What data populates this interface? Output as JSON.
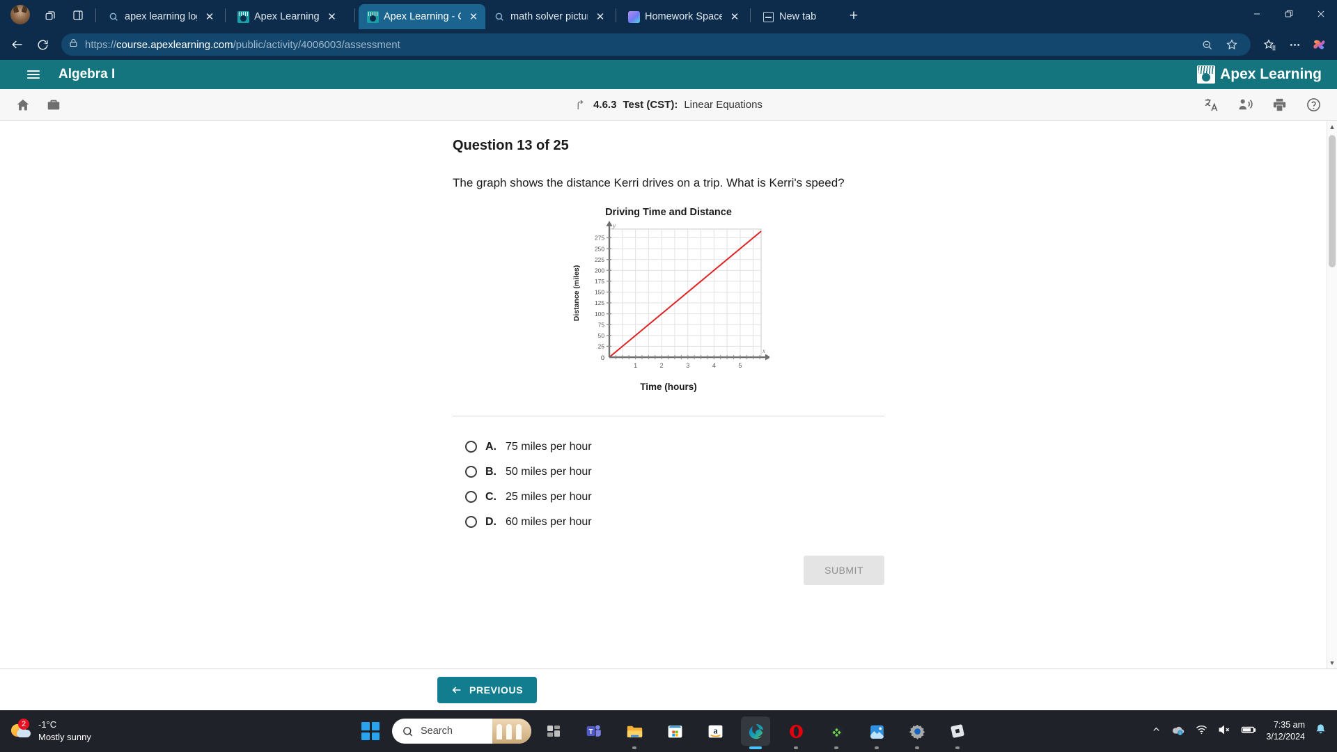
{
  "browser": {
    "tabs": [
      {
        "title": "apex learning log in - Sear",
        "favicon": "search-icon",
        "active": false
      },
      {
        "title": "Apex Learning",
        "favicon": "apex-icon",
        "active": false
      },
      {
        "title": "Apex Learning - Courses",
        "favicon": "apex-icon",
        "active": true
      },
      {
        "title": "math solver picture - Sear",
        "favicon": "search-icon",
        "active": false
      },
      {
        "title": "Homework Space - Study",
        "favicon": "homework-icon",
        "active": false
      },
      {
        "title": "New tab",
        "favicon": "newtab-icon",
        "active": false
      }
    ],
    "address": {
      "scheme": "https://",
      "domain": "course.apexlearning.com",
      "path": "/public/activity/4006003/assessment"
    },
    "accent_color": "#0d2c4b",
    "active_tab_color": "#1b648f"
  },
  "app": {
    "course_title": "Algebra I",
    "logo_text": "Apex Learning",
    "header_color": "#14757f",
    "lesson": {
      "number": "4.6.3",
      "type": "Test (CST):",
      "name": "Linear Equations"
    }
  },
  "question": {
    "heading": "Question 13 of 25",
    "prompt": "The graph shows the distance Kerri drives on a trip. What is Kerri's speed?",
    "options": [
      {
        "letter": "A.",
        "text": "75 miles per hour",
        "selected": false
      },
      {
        "letter": "B.",
        "text": "50 miles per hour",
        "selected": false
      },
      {
        "letter": "C.",
        "text": "25 miles per hour",
        "selected": false
      },
      {
        "letter": "D.",
        "text": "60 miles per hour",
        "selected": false
      }
    ],
    "submit_label": "SUBMIT",
    "previous_label": "PREVIOUS"
  },
  "chart_data": {
    "type": "line",
    "title": "Driving Time and Distance",
    "xlabel": "Time (hours)",
    "ylabel": "Distance (miles)",
    "x_axis_name": "x",
    "y_axis_name": "y",
    "xlim": [
      0,
      5.8
    ],
    "ylim": [
      0,
      295
    ],
    "xticks": [
      0,
      1,
      2,
      3,
      4,
      5
    ],
    "xtick_labels": [
      "0",
      "1",
      "2",
      "3",
      "4",
      "5"
    ],
    "x_minor_step": 0.25,
    "yticks": [
      25,
      50,
      75,
      100,
      125,
      150,
      175,
      200,
      225,
      250,
      275
    ],
    "ytick_labels": [
      "25",
      "50",
      "75",
      "100",
      "125",
      "150",
      "175",
      "200",
      "225",
      "250",
      "275"
    ],
    "grid": true,
    "series": [
      {
        "name": "distance",
        "color": "#e02020",
        "points": [
          [
            0,
            0
          ],
          [
            5.8,
            290
          ]
        ],
        "slope": 50
      }
    ]
  },
  "taskbar": {
    "weather": {
      "temperature": "-1°C",
      "condition": "Mostly sunny",
      "badge": "2"
    },
    "search_placeholder": "Search",
    "clock": {
      "time": "7:35 am",
      "date": "3/12/2024"
    },
    "apps": [
      "widgets-icon",
      "task-view-icon",
      "teams-icon",
      "file-explorer-icon",
      "microsoft-store-icon",
      "amazon-icon",
      "edge-icon",
      "opera-icon",
      "xbox-icon",
      "photos-icon",
      "settings-icon",
      "roblox-icon"
    ],
    "tray": [
      "chevron-up-icon",
      "onedrive-icon",
      "wifi-icon",
      "volume-muted-icon",
      "battery-icon",
      "notification-bell-icon"
    ]
  }
}
